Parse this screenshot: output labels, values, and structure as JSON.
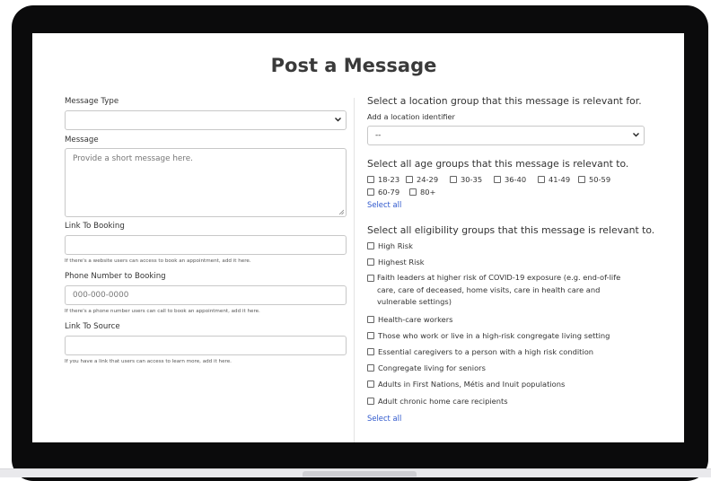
{
  "page": {
    "title": "Post a Message"
  },
  "left": {
    "message_type": {
      "label": "Message Type",
      "value": ""
    },
    "message": {
      "label": "Message",
      "placeholder": "Provide a short message here."
    },
    "link_booking": {
      "label": "Link To Booking",
      "help": "If there's a website users can access to book an appointment, add it here."
    },
    "phone": {
      "label": "Phone Number to Booking",
      "placeholder": "000-000-0000",
      "help": "If there's a phone number users can call to book an appointment, add it here."
    },
    "link_source": {
      "label": "Link To Source",
      "help": "If you have a link that users can access to learn more, add it here."
    }
  },
  "right": {
    "location": {
      "heading": "Select a location group that this message is relevant for.",
      "sublabel": "Add a location identifier",
      "value": "--"
    },
    "age": {
      "heading": "Select all age groups that this message is relevant to.",
      "options": [
        "18-23",
        "24-29",
        "30-35",
        "36-40",
        "41-49",
        "50-59",
        "60-79",
        "80+"
      ],
      "select_all": "Select all"
    },
    "eligibility": {
      "heading": "Select all eligibility groups that this message is relevant to.",
      "options": [
        "High Risk",
        "Highest Risk",
        "Faith leaders at higher risk of COVID-19 exposure (e.g. end-of-life care, care of deceased, home visits, care in health care and vulnerable settings)",
        "Health-care workers",
        "Those who work or live in a high-risk congregate living setting",
        "Essential caregivers to a person with a high risk condition",
        "Congregate living for seniors",
        "Adults in First Nations, Métis and Inuit populations",
        "Adult chronic home care recipients"
      ],
      "select_all": "Select all"
    }
  },
  "icons": {
    "select_arrow": "chevron-down-icon",
    "resize": "resize-grip-icon"
  }
}
